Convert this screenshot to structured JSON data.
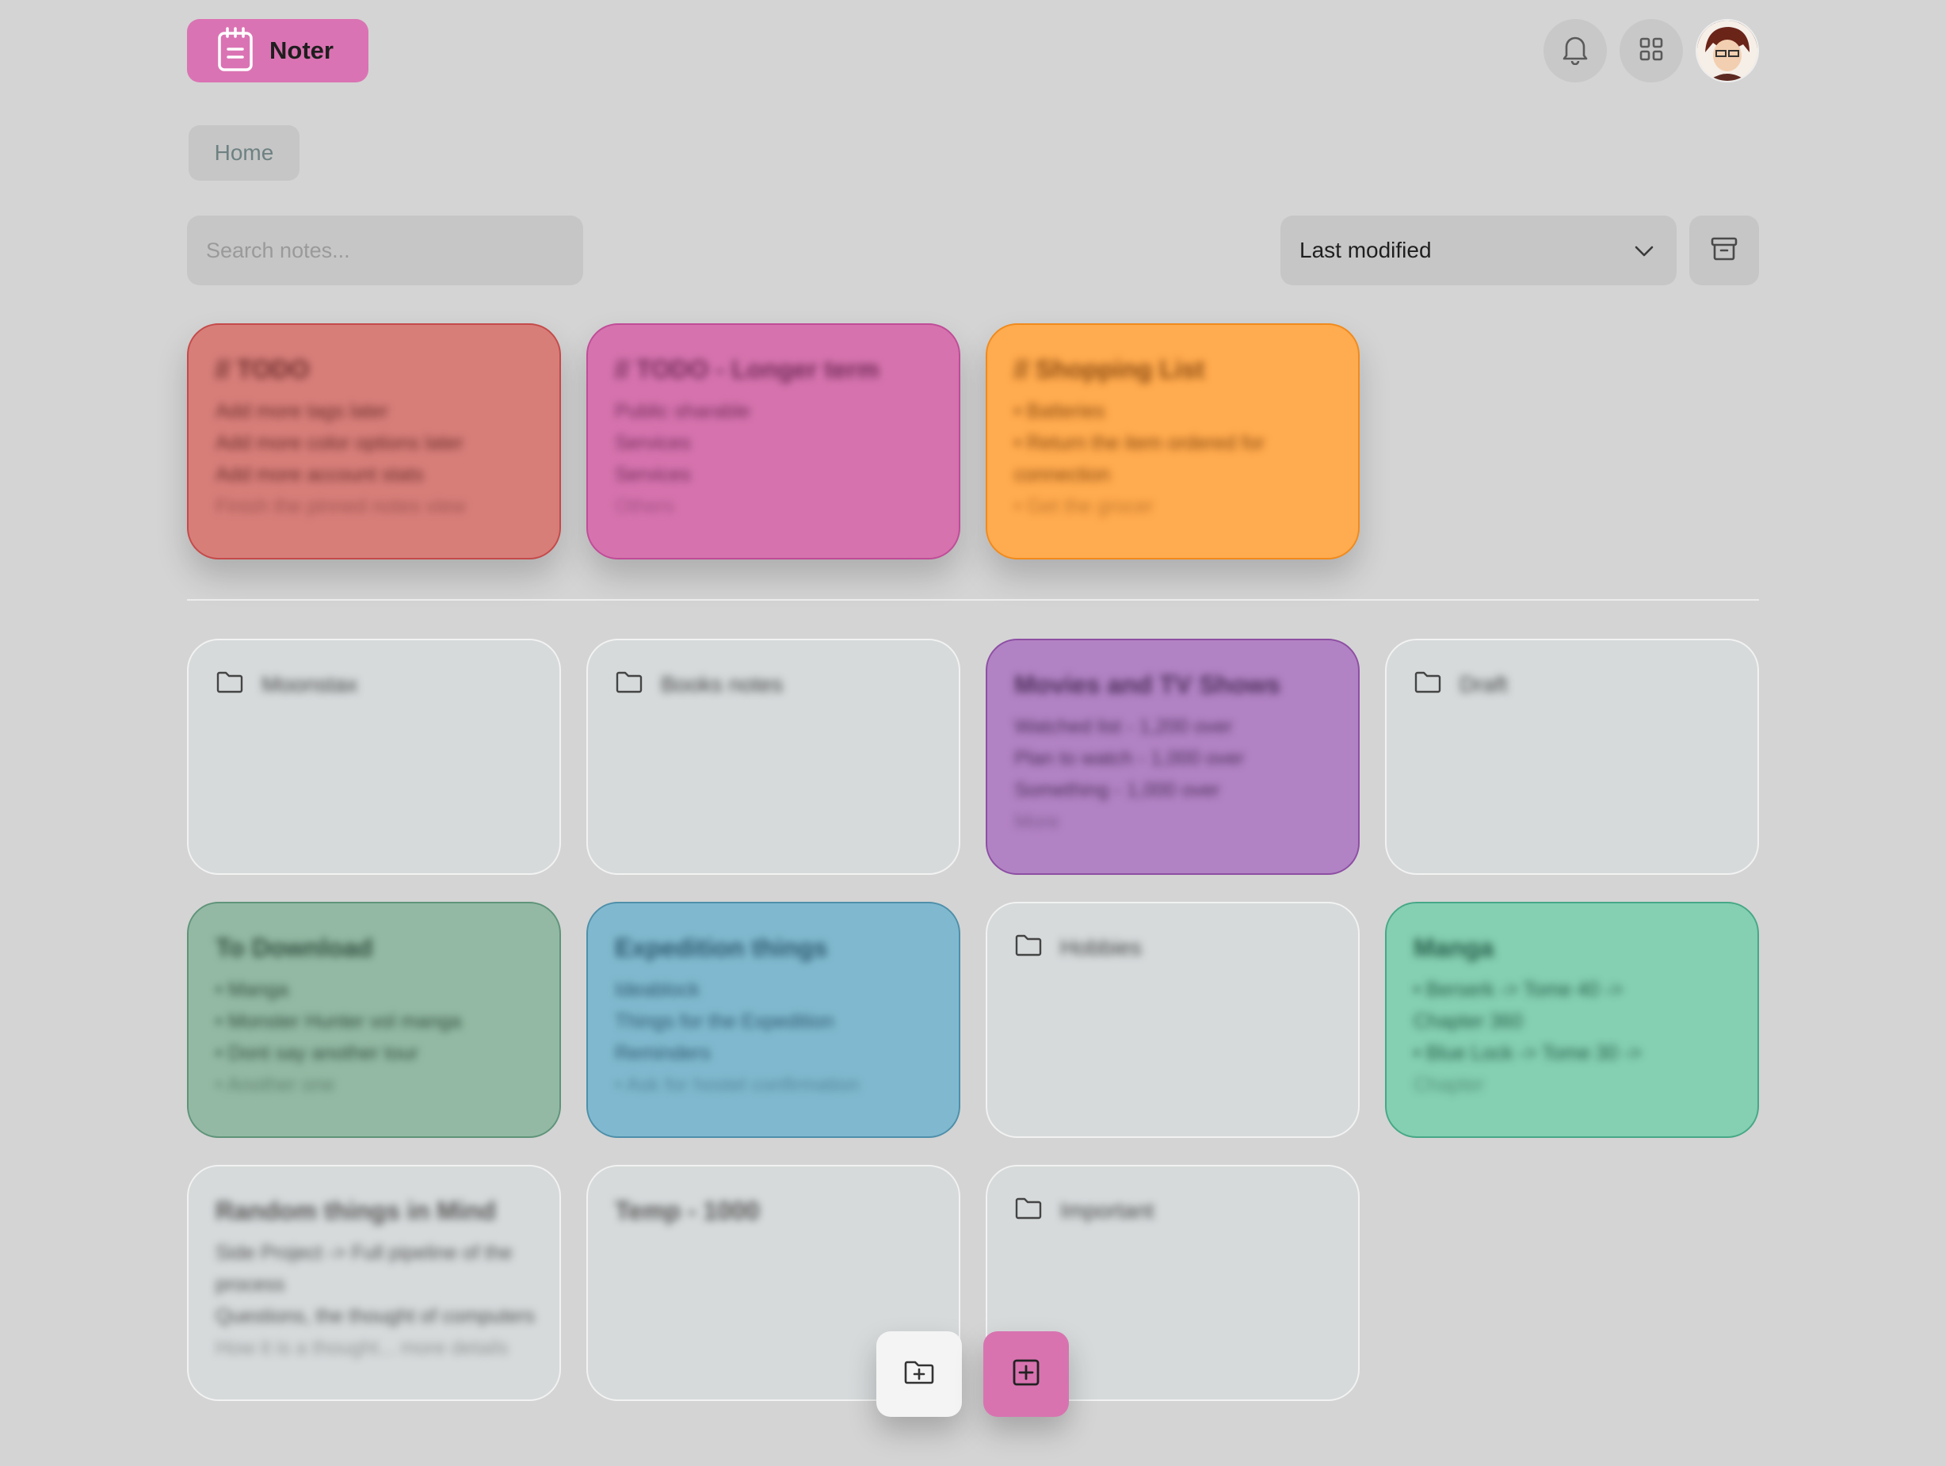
{
  "header": {
    "app_name": "Noter",
    "notifications_icon": "bell-icon",
    "apps_icon": "grid-icon"
  },
  "breadcrumb": {
    "home": "Home"
  },
  "search": {
    "placeholder": "Search notes...",
    "value": ""
  },
  "sort": {
    "selected": "Last modified"
  },
  "colors": {
    "brand": "#da73b3",
    "background": "#d4d4d4",
    "red": "#d77e79",
    "pink": "#d673ae",
    "orange": "#ffab4f",
    "purple": "#b283c4",
    "sage": "#93b9a4",
    "blue": "#80b9cf",
    "mint": "#85cfb2",
    "folder": "#d6dadb"
  },
  "pinned_notes": [
    {
      "title": "// TODO",
      "lines": [
        "Add more tags later",
        "Add more color options later",
        "Add more account stats",
        "Finish the pinned notes view"
      ]
    },
    {
      "title": "// TODO - Longer term",
      "lines": [
        "Public sharable",
        "Services",
        "Services",
        "Others"
      ]
    },
    {
      "title": "// Shopping List",
      "lines": [
        "• Batteries",
        "• Return the item ordered for",
        "  connection",
        "• Get the grocer"
      ]
    }
  ],
  "items": {
    "folder_1": "Moonstax",
    "folder_2": "Books notes",
    "movies": {
      "title": "Movies and TV Shows",
      "lines": [
        "Watched list - 1,200 over",
        "Plan to watch - 1,000 over",
        "Something - 1,000 over",
        "More"
      ]
    },
    "folder_3": "Draft",
    "to_download": {
      "title": "To Download",
      "lines": [
        "• Manga",
        "  • Monster Hunter vol manga",
        "  • Dont say another tour",
        "  • Another one"
      ]
    },
    "expedition": {
      "title": "Expedition things",
      "lines": [
        "Ideablock",
        "Things for the Expedition",
        "Reminders",
        "• Ask for hostel confirmation"
      ]
    },
    "folder_4": "Hobbies",
    "manga": {
      "title": "Manga",
      "lines": [
        "• Berserk -> Tome 40 ->",
        "  Chapter 360",
        "• Blue Lock -> Tome 30 ->",
        "  Chapter"
      ]
    },
    "random": {
      "title": "Random things in Mind",
      "lines": [
        "Side Project -> Full pipeline of the",
        "process",
        "Questions, the thought of computers",
        "How it is a thought... more details"
      ]
    },
    "temp": {
      "title": "Temp - 1000",
      "lines": []
    },
    "folder_5": "Important"
  },
  "fab": {
    "new_folder_icon": "folder-plus-icon",
    "new_note_icon": "note-plus-icon"
  }
}
